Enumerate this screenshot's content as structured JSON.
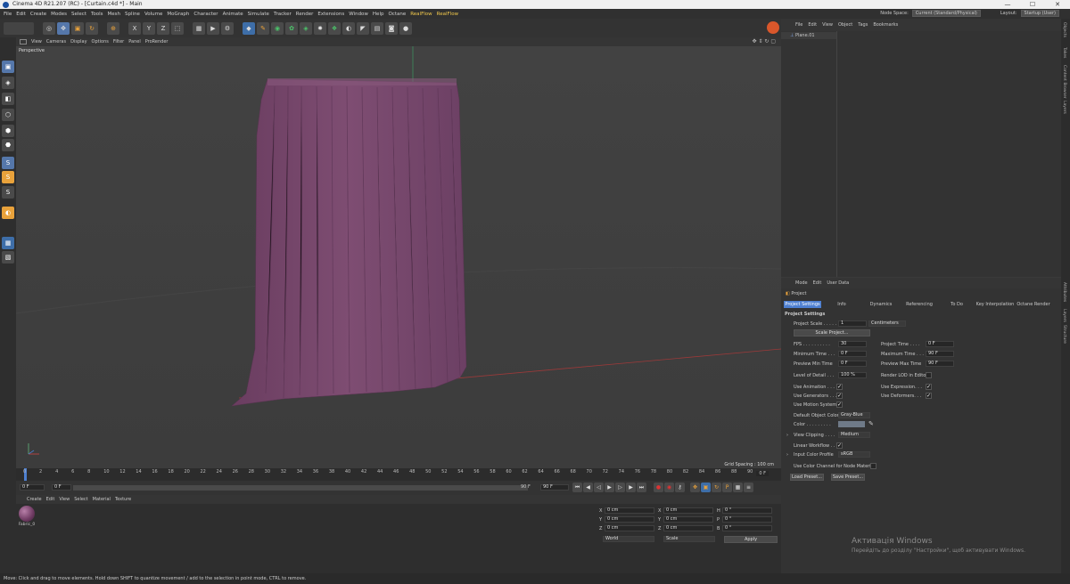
{
  "window": {
    "title": "Cinema 4D R21.207 (RC) - [Curtain.c4d *] - Main",
    "controls": [
      "—",
      "☐",
      "✕"
    ]
  },
  "menu": {
    "items": [
      "File",
      "Edit",
      "Create",
      "Modes",
      "Select",
      "Tools",
      "Mesh",
      "Spline",
      "Volume",
      "MoGraph",
      "Character",
      "Animate",
      "Simulate",
      "Tracker",
      "Render",
      "Extensions",
      "Window",
      "Help",
      "Octane"
    ],
    "plugins": [
      "RealFlow",
      "RealFlow"
    ],
    "node_space_label": "Node Space:",
    "node_space_value": "Current (Standard/Physical)",
    "layout_label": "Layout:",
    "layout_value": "Startup (User)"
  },
  "viewport": {
    "menu": [
      "View",
      "Cameras",
      "Display",
      "Options",
      "Filter",
      "Panel",
      "ProRender"
    ],
    "label": "Perspective",
    "grid_spacing": "Grid Spacing : 100 cm"
  },
  "timeline": {
    "ticks": [
      "0",
      "2",
      "4",
      "6",
      "8",
      "10",
      "12",
      "14",
      "16",
      "18",
      "20",
      "22",
      "24",
      "26",
      "28",
      "30",
      "32",
      "34",
      "36",
      "38",
      "40",
      "42",
      "44",
      "46",
      "48",
      "50",
      "52",
      "54",
      "56",
      "58",
      "60",
      "62",
      "64",
      "66",
      "68",
      "70",
      "72",
      "74",
      "76",
      "78",
      "80",
      "82",
      "84",
      "86",
      "88",
      "90"
    ],
    "end_frame": "0 F"
  },
  "transport": {
    "current": "0 F",
    "start": "0 F",
    "end": "90 F",
    "max": "90 F"
  },
  "materials": {
    "menu": [
      "Create",
      "Edit",
      "View",
      "Select",
      "Material",
      "Texture"
    ],
    "items": [
      {
        "name": "Fabric_0"
      }
    ]
  },
  "coords": {
    "rows": [
      {
        "axis1": "X",
        "val1": "0 cm",
        "axis2": "X",
        "val2": "0 cm",
        "axis3": "H",
        "val3": "0 °"
      },
      {
        "axis1": "Y",
        "val1": "0 cm",
        "axis2": "Y",
        "val2": "0 cm",
        "axis3": "P",
        "val3": "0 °"
      },
      {
        "axis1": "Z",
        "val1": "0 cm",
        "axis2": "Z",
        "val2": "0 cm",
        "axis3": "B",
        "val3": "0 °"
      }
    ],
    "mode1": "World",
    "mode2": "Scale",
    "apply": "Apply"
  },
  "objects": {
    "menu": [
      "File",
      "Edit",
      "View",
      "Object",
      "Tags",
      "Bookmarks"
    ],
    "items": [
      {
        "name": "Plane.01"
      }
    ]
  },
  "attributes": {
    "menu": [
      "Mode",
      "Edit",
      "User Data"
    ],
    "object": "Project",
    "tabs": [
      "Project Settings",
      "Info",
      "Dynamics",
      "Referencing",
      "To Do",
      "Key Interpolation",
      "Octane Render"
    ],
    "section": "Project Settings",
    "project_scale_label": "Project Scale . . . . .",
    "project_scale_value": "1",
    "project_scale_unit": "Centimeters",
    "scale_project_btn": "Scale Project...",
    "fps_label": "FPS . . . . . . . . . .",
    "fps_value": "30",
    "project_time_label": "Project Time . . . .",
    "project_time_value": "0 F",
    "min_time_label": "Minimum Time . . .",
    "min_time_value": "0 F",
    "max_time_label": "Maximum Time . . .",
    "max_time_value": "90 F",
    "prev_min_label": "Preview Min Time",
    "prev_min_value": "0 F",
    "prev_max_label": "Preview Max Time",
    "prev_max_value": "90 F",
    "lod_label": "Level of Detail . . .",
    "lod_value": "100 %",
    "render_lod_label": "Render LOD in Editor",
    "use_animation": "Use Animation . . .",
    "use_expression": "Use Expression. . .",
    "use_generators": "Use Generators . . .",
    "use_deformers": "Use Deformers. . .",
    "use_motion": "Use Motion System",
    "default_color_label": "Default Object Color",
    "default_color_value": "Gray-Blue",
    "color_label": "Color . . . . . . . . .",
    "view_clipping_label": "View Clipping . . . .",
    "view_clipping_value": "Medium",
    "linear_workflow": "Linear Workflow . .",
    "input_color_label": "Input Color Profile",
    "input_color_value": "sRGB",
    "use_color_channel": "Use Color Channel for Node Material",
    "load_preset": "Load Preset...",
    "save_preset": "Save Preset..."
  },
  "side_tabs": [
    "Objects",
    "Takes",
    "Content Browser",
    "Layers",
    "Attributes",
    "Layers",
    "Structure"
  ],
  "status": "Move: Click and drag to move elements. Hold down SHIFT to quantize movement / add to the selection in point mode, CTRL to remove.",
  "activation": {
    "title": "Активація Windows",
    "subtitle": "Перейдіть до розділу \"Настройки\", щоб активувати Windows."
  },
  "colors": {
    "curtain": "#7a4a6e",
    "accent": "#4d7fd0",
    "plugin_menu": "#f2c94c"
  }
}
